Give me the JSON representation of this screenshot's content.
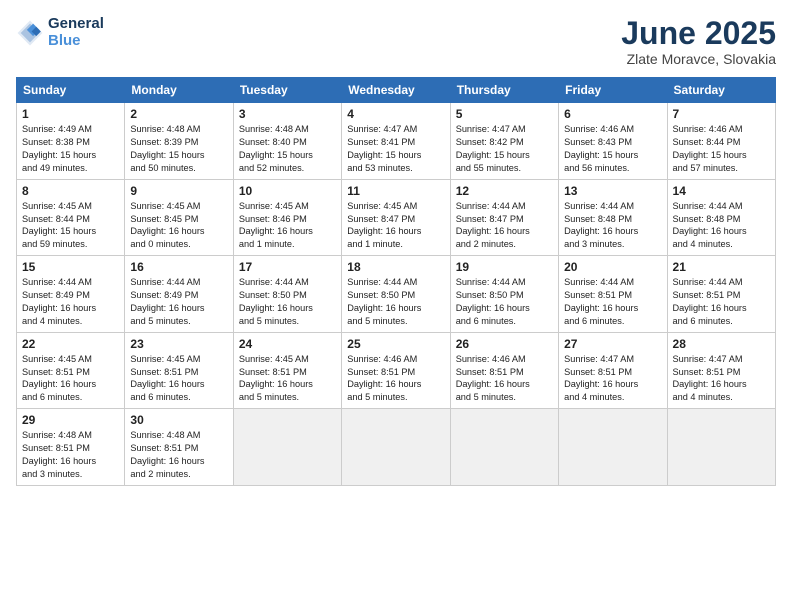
{
  "header": {
    "logo_line1": "General",
    "logo_line2": "Blue",
    "month": "June 2025",
    "location": "Zlate Moravce, Slovakia"
  },
  "weekdays": [
    "Sunday",
    "Monday",
    "Tuesday",
    "Wednesday",
    "Thursday",
    "Friday",
    "Saturday"
  ],
  "weeks": [
    [
      {
        "day": "1",
        "info": "Sunrise: 4:49 AM\nSunset: 8:38 PM\nDaylight: 15 hours\nand 49 minutes."
      },
      {
        "day": "2",
        "info": "Sunrise: 4:48 AM\nSunset: 8:39 PM\nDaylight: 15 hours\nand 50 minutes."
      },
      {
        "day": "3",
        "info": "Sunrise: 4:48 AM\nSunset: 8:40 PM\nDaylight: 15 hours\nand 52 minutes."
      },
      {
        "day": "4",
        "info": "Sunrise: 4:47 AM\nSunset: 8:41 PM\nDaylight: 15 hours\nand 53 minutes."
      },
      {
        "day": "5",
        "info": "Sunrise: 4:47 AM\nSunset: 8:42 PM\nDaylight: 15 hours\nand 55 minutes."
      },
      {
        "day": "6",
        "info": "Sunrise: 4:46 AM\nSunset: 8:43 PM\nDaylight: 15 hours\nand 56 minutes."
      },
      {
        "day": "7",
        "info": "Sunrise: 4:46 AM\nSunset: 8:44 PM\nDaylight: 15 hours\nand 57 minutes."
      }
    ],
    [
      {
        "day": "8",
        "info": "Sunrise: 4:45 AM\nSunset: 8:44 PM\nDaylight: 15 hours\nand 59 minutes."
      },
      {
        "day": "9",
        "info": "Sunrise: 4:45 AM\nSunset: 8:45 PM\nDaylight: 16 hours\nand 0 minutes."
      },
      {
        "day": "10",
        "info": "Sunrise: 4:45 AM\nSunset: 8:46 PM\nDaylight: 16 hours\nand 1 minute."
      },
      {
        "day": "11",
        "info": "Sunrise: 4:45 AM\nSunset: 8:47 PM\nDaylight: 16 hours\nand 1 minute."
      },
      {
        "day": "12",
        "info": "Sunrise: 4:44 AM\nSunset: 8:47 PM\nDaylight: 16 hours\nand 2 minutes."
      },
      {
        "day": "13",
        "info": "Sunrise: 4:44 AM\nSunset: 8:48 PM\nDaylight: 16 hours\nand 3 minutes."
      },
      {
        "day": "14",
        "info": "Sunrise: 4:44 AM\nSunset: 8:48 PM\nDaylight: 16 hours\nand 4 minutes."
      }
    ],
    [
      {
        "day": "15",
        "info": "Sunrise: 4:44 AM\nSunset: 8:49 PM\nDaylight: 16 hours\nand 4 minutes."
      },
      {
        "day": "16",
        "info": "Sunrise: 4:44 AM\nSunset: 8:49 PM\nDaylight: 16 hours\nand 5 minutes."
      },
      {
        "day": "17",
        "info": "Sunrise: 4:44 AM\nSunset: 8:50 PM\nDaylight: 16 hours\nand 5 minutes."
      },
      {
        "day": "18",
        "info": "Sunrise: 4:44 AM\nSunset: 8:50 PM\nDaylight: 16 hours\nand 5 minutes."
      },
      {
        "day": "19",
        "info": "Sunrise: 4:44 AM\nSunset: 8:50 PM\nDaylight: 16 hours\nand 6 minutes."
      },
      {
        "day": "20",
        "info": "Sunrise: 4:44 AM\nSunset: 8:51 PM\nDaylight: 16 hours\nand 6 minutes."
      },
      {
        "day": "21",
        "info": "Sunrise: 4:44 AM\nSunset: 8:51 PM\nDaylight: 16 hours\nand 6 minutes."
      }
    ],
    [
      {
        "day": "22",
        "info": "Sunrise: 4:45 AM\nSunset: 8:51 PM\nDaylight: 16 hours\nand 6 minutes."
      },
      {
        "day": "23",
        "info": "Sunrise: 4:45 AM\nSunset: 8:51 PM\nDaylight: 16 hours\nand 6 minutes."
      },
      {
        "day": "24",
        "info": "Sunrise: 4:45 AM\nSunset: 8:51 PM\nDaylight: 16 hours\nand 5 minutes."
      },
      {
        "day": "25",
        "info": "Sunrise: 4:46 AM\nSunset: 8:51 PM\nDaylight: 16 hours\nand 5 minutes."
      },
      {
        "day": "26",
        "info": "Sunrise: 4:46 AM\nSunset: 8:51 PM\nDaylight: 16 hours\nand 5 minutes."
      },
      {
        "day": "27",
        "info": "Sunrise: 4:47 AM\nSunset: 8:51 PM\nDaylight: 16 hours\nand 4 minutes."
      },
      {
        "day": "28",
        "info": "Sunrise: 4:47 AM\nSunset: 8:51 PM\nDaylight: 16 hours\nand 4 minutes."
      }
    ],
    [
      {
        "day": "29",
        "info": "Sunrise: 4:48 AM\nSunset: 8:51 PM\nDaylight: 16 hours\nand 3 minutes."
      },
      {
        "day": "30",
        "info": "Sunrise: 4:48 AM\nSunset: 8:51 PM\nDaylight: 16 hours\nand 2 minutes."
      },
      {
        "day": "",
        "info": ""
      },
      {
        "day": "",
        "info": ""
      },
      {
        "day": "",
        "info": ""
      },
      {
        "day": "",
        "info": ""
      },
      {
        "day": "",
        "info": ""
      }
    ]
  ]
}
